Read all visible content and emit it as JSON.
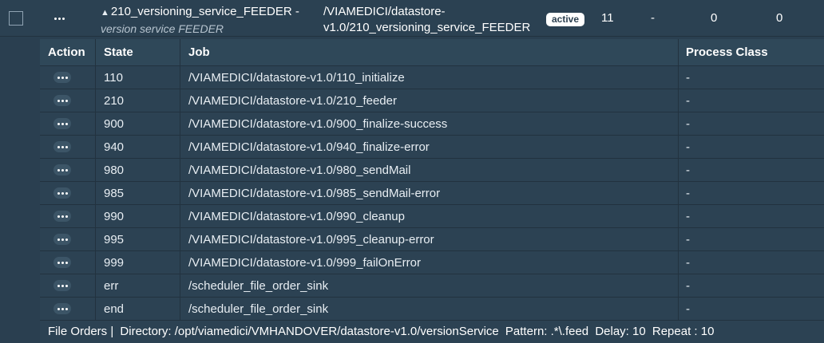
{
  "order": {
    "title": "210_versioning_service_FEEDER -",
    "subtitle": "version service FEEDER",
    "path_line1": "/VIAMEDICI/datastore-",
    "path_line2": "v1.0/210_versioning_service_FEEDER",
    "status": "active",
    "col1": "11",
    "col2": "-",
    "col3": "0",
    "col4": "0"
  },
  "table": {
    "headers": {
      "action": "Action",
      "state": "State",
      "job": "Job",
      "process_class": "Process Class"
    },
    "rows": [
      {
        "state": "110",
        "job": "/VIAMEDICI/datastore-v1.0/110_initialize",
        "process_class": "-"
      },
      {
        "state": "210",
        "job": "/VIAMEDICI/datastore-v1.0/210_feeder",
        "process_class": "-"
      },
      {
        "state": "900",
        "job": "/VIAMEDICI/datastore-v1.0/900_finalize-success",
        "process_class": "-"
      },
      {
        "state": "940",
        "job": "/VIAMEDICI/datastore-v1.0/940_finalize-error",
        "process_class": "-"
      },
      {
        "state": "980",
        "job": "/VIAMEDICI/datastore-v1.0/980_sendMail",
        "process_class": "-"
      },
      {
        "state": "985",
        "job": "/VIAMEDICI/datastore-v1.0/985_sendMail-error",
        "process_class": "-"
      },
      {
        "state": "990",
        "job": "/VIAMEDICI/datastore-v1.0/990_cleanup",
        "process_class": "-"
      },
      {
        "state": "995",
        "job": "/VIAMEDICI/datastore-v1.0/995_cleanup-error",
        "process_class": "-"
      },
      {
        "state": "999",
        "job": "/VIAMEDICI/datastore-v1.0/999_failOnError",
        "process_class": "-"
      },
      {
        "state": "err",
        "job": "/scheduler_file_order_sink",
        "process_class": "-"
      },
      {
        "state": "end",
        "job": "/scheduler_file_order_sink",
        "process_class": "-"
      }
    ]
  },
  "footer": {
    "label": "File Orders |",
    "directory": "Directory: /opt/viamedici/VMHANDOVER/datastore-v1.0/versionService",
    "pattern": "Pattern: .*\\.feed",
    "delay": "Delay: 10",
    "repeat": "Repeat : 10"
  }
}
